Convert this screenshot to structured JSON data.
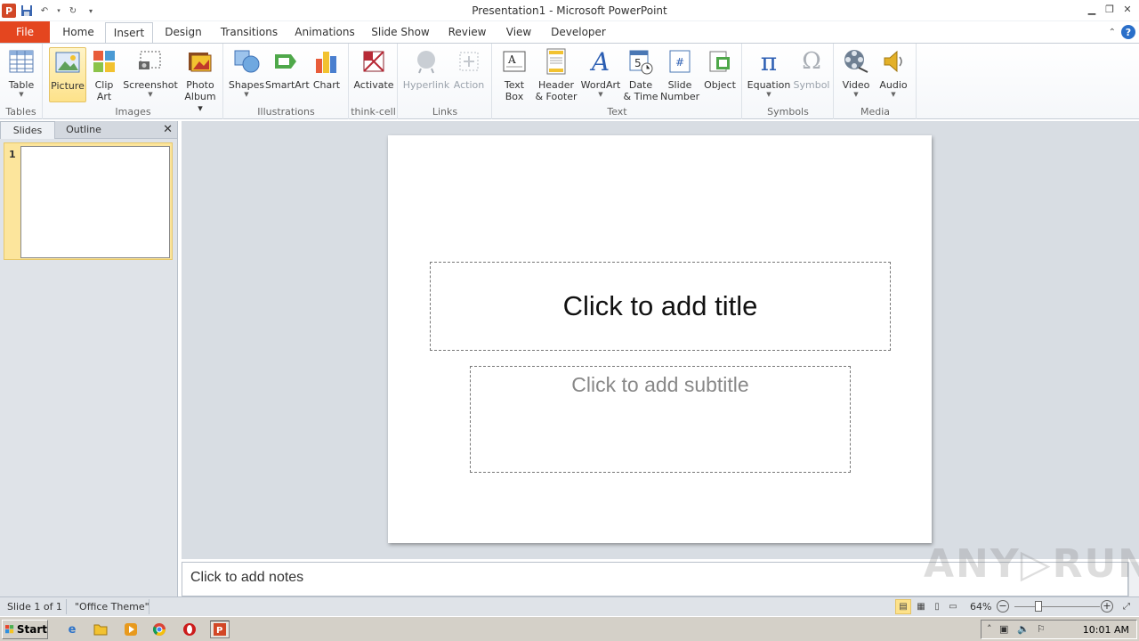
{
  "window": {
    "title": "Presentation1 - Microsoft PowerPoint",
    "app_icon": "P",
    "quick_access": [
      "save-icon",
      "undo-icon",
      "redo-icon",
      "customize-icon"
    ]
  },
  "tabs": [
    {
      "label": "File"
    },
    {
      "label": "Home"
    },
    {
      "label": "Insert"
    },
    {
      "label": "Design"
    },
    {
      "label": "Transitions"
    },
    {
      "label": "Animations"
    },
    {
      "label": "Slide Show"
    },
    {
      "label": "Review"
    },
    {
      "label": "View"
    },
    {
      "label": "Developer"
    }
  ],
  "active_tab": "Insert",
  "ribbon": {
    "groups": [
      {
        "label": "Tables",
        "buttons": [
          {
            "line1": "Table",
            "line2": "",
            "dropdown": true
          }
        ]
      },
      {
        "label": "Images",
        "buttons": [
          {
            "line1": "Picture",
            "line2": "",
            "selected": true
          },
          {
            "line1": "Clip",
            "line2": "Art"
          },
          {
            "line1": "Screenshot",
            "line2": "",
            "dropdown": true
          },
          {
            "line1": "Photo",
            "line2": "Album ▾"
          }
        ]
      },
      {
        "label": "Illustrations",
        "buttons": [
          {
            "line1": "Shapes",
            "line2": "",
            "dropdown": true
          },
          {
            "line1": "SmartArt",
            "line2": ""
          },
          {
            "line1": "Chart",
            "line2": ""
          }
        ]
      },
      {
        "label": "think-cell",
        "buttons": [
          {
            "line1": "Activate",
            "line2": ""
          }
        ]
      },
      {
        "label": "Links",
        "buttons": [
          {
            "line1": "Hyperlink",
            "line2": "",
            "disabled": true
          },
          {
            "line1": "Action",
            "line2": "",
            "disabled": true
          }
        ]
      },
      {
        "label": "Text",
        "buttons": [
          {
            "line1": "Text",
            "line2": "Box"
          },
          {
            "line1": "Header",
            "line2": "& Footer"
          },
          {
            "line1": "WordArt",
            "line2": "",
            "dropdown": true
          },
          {
            "line1": "Date",
            "line2": "& Time"
          },
          {
            "line1": "Slide",
            "line2": "Number"
          },
          {
            "line1": "Object",
            "line2": ""
          }
        ]
      },
      {
        "label": "Symbols",
        "buttons": [
          {
            "line1": "Equation",
            "line2": "",
            "dropdown": true
          },
          {
            "line1": "Symbol",
            "line2": "",
            "disabled": true
          }
        ]
      },
      {
        "label": "Media",
        "buttons": [
          {
            "line1": "Video",
            "line2": "",
            "dropdown": true
          },
          {
            "line1": "Audio",
            "line2": "",
            "dropdown": true
          }
        ]
      }
    ]
  },
  "left_panel": {
    "tabs": [
      "Slides",
      "Outline"
    ],
    "active": "Slides",
    "slide_number": "1"
  },
  "slide": {
    "title_placeholder": "Click to add title",
    "subtitle_placeholder": "Click to add subtitle"
  },
  "notes_placeholder": "Click to add notes",
  "watermark": "ANY▷RUN",
  "status": {
    "slide_info": "Slide 1 of 1",
    "theme": "\"Office Theme\"",
    "zoom": "64%",
    "zoom_level": 0.64
  },
  "taskbar": {
    "start": "Start",
    "clock": "10:01 AM"
  },
  "colors": {
    "file_tab": "#e4461f",
    "selected_button": "#fde28a",
    "thumbnail_selected": "#fce59c"
  }
}
